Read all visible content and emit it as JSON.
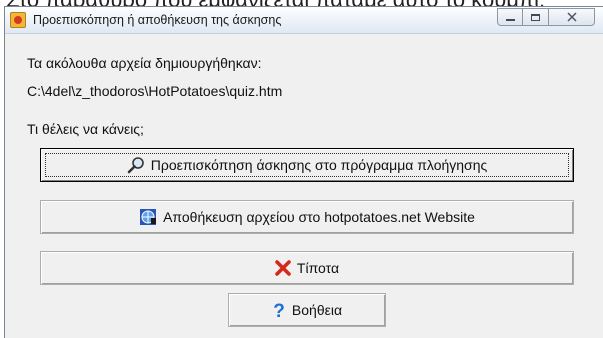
{
  "background_text": "Στο παράθυρο που εμφανίζεται πατάμε αυτό το κουμπί:",
  "window": {
    "title": "Προεπισκόπηση ή αποθήκευση της άσκησης"
  },
  "content": {
    "files_created_label": "Τα ακόλουθα αρχεία δημιουργήθηκαν:",
    "file_path": "C:\\4del\\z_thodoros\\HotPotatoes\\quiz.htm",
    "question": "Τι θέλεις να κάνεις;"
  },
  "buttons": {
    "preview": "Προεπισκόπηση άσκησης στο πρόγραμμα πλοήγησης",
    "upload": "Αποθήκευση αρχείου στο hotpotatoes.net Website",
    "nothing": "Τίποτα",
    "help": "Βοήθεια"
  },
  "icons": {
    "preview": "magnifier-icon",
    "upload": "network-globe-icon",
    "nothing": "red-x-icon",
    "help": "question-mark-icon"
  },
  "colors": {
    "red_x": "#d42a1a",
    "help_blue": "#1d6fd6"
  }
}
